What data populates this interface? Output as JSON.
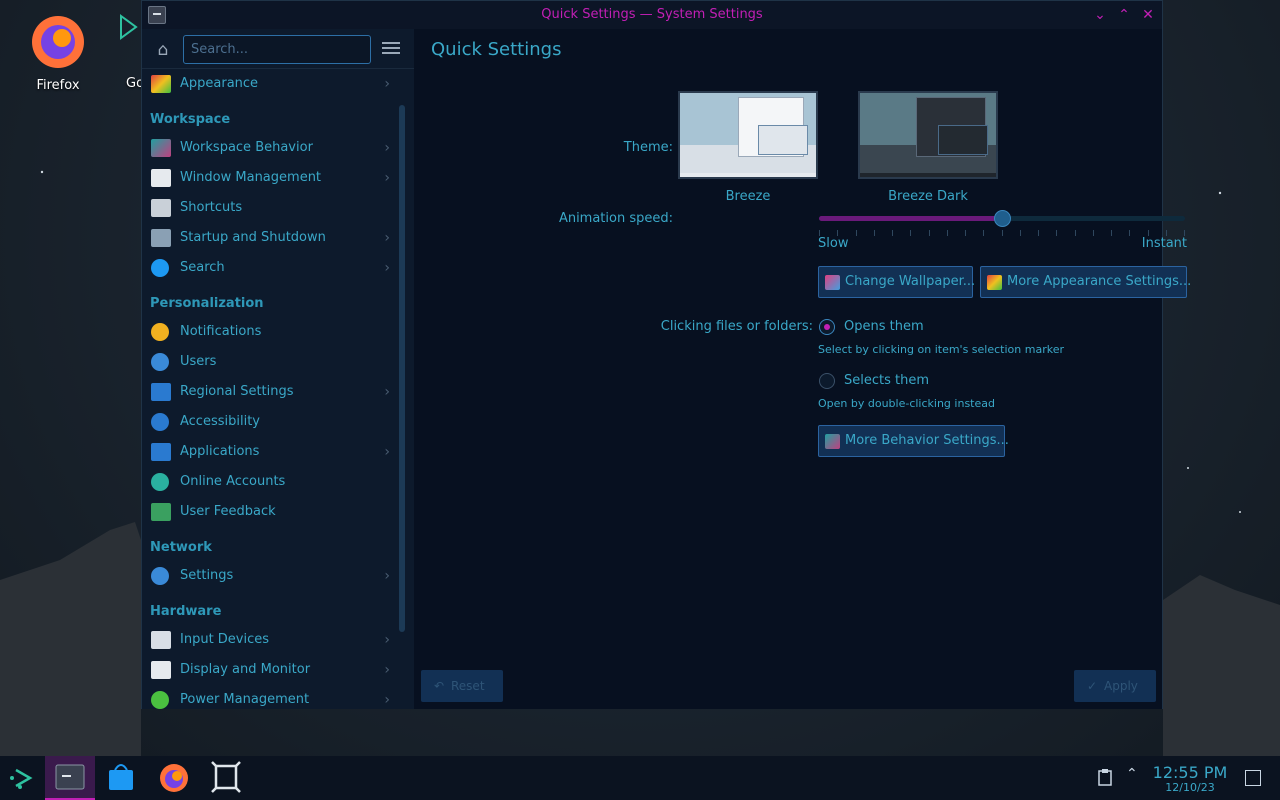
{
  "colors": {
    "accent": "#3aa8c8",
    "titlebar_text": "#c21fb5",
    "window_bg": "#0a1220",
    "sidebar_bg": "#0d1a2c",
    "button_bg": "#123054"
  },
  "desktop": {
    "icons": [
      {
        "label": "Firefox",
        "icon": "firefox-icon"
      },
      {
        "label": "Go",
        "icon": "go-icon"
      }
    ]
  },
  "window": {
    "title": "Quick Settings — System Settings",
    "buttons": {
      "minimize": "⌄",
      "maximize": "⌃",
      "close": "✕"
    }
  },
  "sidebar": {
    "search_placeholder": "Search...",
    "items": [
      {
        "label": "Appearance",
        "icon": "appearance-icon",
        "chevron": true
      },
      {
        "category": "Workspace"
      },
      {
        "label": "Workspace Behavior",
        "icon": "workspace-behavior-icon",
        "chevron": true
      },
      {
        "label": "Window Management",
        "icon": "window-management-icon",
        "chevron": true
      },
      {
        "label": "Shortcuts",
        "icon": "keyboard-icon",
        "chevron": false
      },
      {
        "label": "Startup and Shutdown",
        "icon": "startup-icon",
        "chevron": true
      },
      {
        "label": "Search",
        "icon": "search-icon",
        "chevron": true
      },
      {
        "category": "Personalization"
      },
      {
        "label": "Notifications",
        "icon": "bell-icon",
        "chevron": false
      },
      {
        "label": "Users",
        "icon": "users-icon",
        "chevron": false
      },
      {
        "label": "Regional Settings",
        "icon": "regional-icon",
        "chevron": true
      },
      {
        "label": "Accessibility",
        "icon": "accessibility-icon",
        "chevron": false
      },
      {
        "label": "Applications",
        "icon": "applications-icon",
        "chevron": true
      },
      {
        "label": "Online Accounts",
        "icon": "online-accounts-icon",
        "chevron": false
      },
      {
        "label": "User Feedback",
        "icon": "feedback-icon",
        "chevron": false
      },
      {
        "category": "Network"
      },
      {
        "label": "Settings",
        "icon": "globe-icon",
        "chevron": true
      },
      {
        "category": "Hardware"
      },
      {
        "label": "Input Devices",
        "icon": "mouse-icon",
        "chevron": true
      },
      {
        "label": "Display and Monitor",
        "icon": "monitor-icon",
        "chevron": true
      },
      {
        "label": "Power Management",
        "icon": "power-icon",
        "chevron": true
      }
    ]
  },
  "main": {
    "title": "Quick Settings",
    "theme_label": "Theme:",
    "themes": [
      {
        "name": "Breeze"
      },
      {
        "name": "Breeze Dark"
      }
    ],
    "animation_label": "Animation speed:",
    "animation_min": "Slow",
    "animation_max": "Instant",
    "animation_value": 0.5,
    "change_wallpaper": "Change Wallpaper...",
    "more_appearance": "More Appearance Settings...",
    "clicking_label": "Clicking files or folders:",
    "opens_label": "Opens them",
    "opens_hint": "Select by clicking on item's selection marker",
    "selects_label": "Selects them",
    "selects_hint": "Open by double-clicking instead",
    "more_behavior": "More Behavior Settings...",
    "reset": "Reset",
    "apply": "Apply"
  },
  "taskbar": {
    "time": "12:55 PM",
    "date": "12/10/23"
  }
}
